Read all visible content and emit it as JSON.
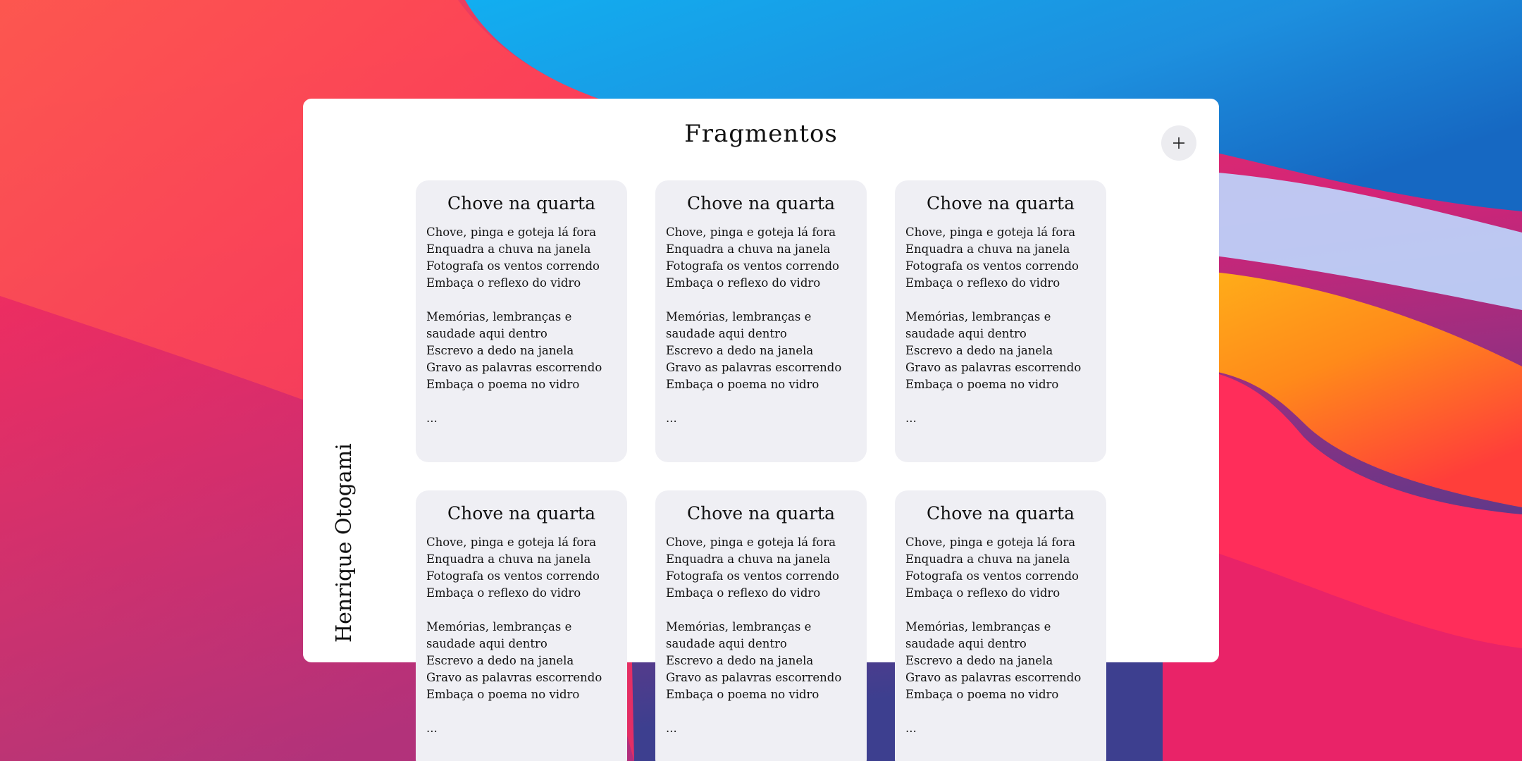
{
  "app": {
    "title": "Fragmentos",
    "author": "Henrique Otogami",
    "add_label": "+"
  },
  "cards": [
    {
      "title": "Chove na quarta",
      "body": "Chove, pinga e goteja lá fora\nEnquadra a chuva na janela\nFotografa os ventos correndo\nEmbaça o reflexo do vidro\n\nMemórias, lembranças e saudade aqui dentro\nEscrevo a dedo na janela\nGravo as palavras escorrendo\nEmbaça o poema no vidro\n\n..."
    },
    {
      "title": "Chove na quarta",
      "body": "Chove, pinga e goteja lá fora\nEnquadra a chuva na janela\nFotografa os ventos correndo\nEmbaça o reflexo do vidro\n\nMemórias, lembranças e saudade aqui dentro\nEscrevo a dedo na janela\nGravo as palavras escorrendo\nEmbaça o poema no vidro\n\n..."
    },
    {
      "title": "Chove na quarta",
      "body": "Chove, pinga e goteja lá fora\nEnquadra a chuva na janela\nFotografa os ventos correndo\nEmbaça o reflexo do vidro\n\nMemórias, lembranças e saudade aqui dentro\nEscrevo a dedo na janela\nGravo as palavras escorrendo\nEmbaça o poema no vidro\n\n..."
    },
    {
      "title": "Chove na quarta",
      "body": "Chove, pinga e goteja lá fora\nEnquadra a chuva na janela\nFotografa os ventos correndo\nEmbaça o reflexo do vidro\n\nMemórias, lembranças e saudade aqui dentro\nEscrevo a dedo na janela\nGravo as palavras escorrendo\nEmbaça o poema no vidro\n\n..."
    },
    {
      "title": "Chove na quarta",
      "body": "Chove, pinga e goteja lá fora\nEnquadra a chuva na janela\nFotografa os ventos correndo\nEmbaça o reflexo do vidro\n\nMemórias, lembranças e saudade aqui dentro\nEscrevo a dedo na janela\nGravo as palavras escorrendo\nEmbaça o poema no vidro\n\n..."
    },
    {
      "title": "Chove na quarta",
      "body": "Chove, pinga e goteja lá fora\nEnquadra a chuva na janela\nFotografa os ventos correndo\nEmbaça o reflexo do vidro\n\nMemórias, lembranças e saudade aqui dentro\nEscrevo a dedo na janela\nGravo as palavras escorrendo\nEmbaça o poema no vidro\n\n..."
    }
  ],
  "colors": {
    "window_bg": "#ffffff",
    "card_bg": "#efeff4",
    "text": "#111111",
    "add_button_bg": "#ececf0"
  }
}
